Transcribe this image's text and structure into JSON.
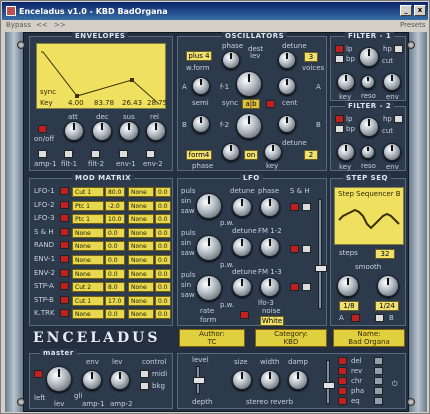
{
  "window": {
    "title": "Enceladus v1.0 - KBD BadOrgana",
    "bypass": "Bypass",
    "nav_prev": "<<",
    "nav_next": ">>",
    "presets": "Presets",
    "close": "x",
    "minimize": "_"
  },
  "envelopes": {
    "title": "ENVELOPES",
    "sync": "sync",
    "key": "Key",
    "values": [
      "4.00",
      "83.78",
      "26.43",
      "28.75"
    ],
    "params": [
      "att",
      "dec",
      "sus",
      "rel"
    ],
    "onoff": "on/off",
    "rows": [
      "amp-1",
      "filt-1",
      "filt-2",
      "env-1",
      "env-2"
    ]
  },
  "oscillators": {
    "title": "OSCILLATORS",
    "preset1": "plus 4",
    "preset2": "form4",
    "phase": "phase",
    "wform": "w.form",
    "dest": "dest",
    "lev": "lev",
    "detune": "detune",
    "voices": "voices",
    "voices1": "3",
    "voices2": "2",
    "semi": "semi",
    "sync": "sync",
    "ab": "a|b",
    "cent": "cent",
    "fmix": "f-1",
    "fmix2": "f-2",
    "on": "on",
    "key": "key",
    "a": "A",
    "b": "B"
  },
  "filter1": {
    "title": "FILTER - 1",
    "lp": "lp",
    "bp": "bp",
    "hp": "hp",
    "cut": "cut",
    "res": "reso",
    "env": "env",
    "key": "key"
  },
  "filter2": {
    "title": "FILTER - 2",
    "lp": "lp",
    "bp": "bp",
    "hp": "hp",
    "cut": "cut",
    "res": "reso",
    "env": "env",
    "key": "key"
  },
  "modmatrix": {
    "title": "MOD MATRIX",
    "rows": [
      {
        "src": "LFO-1",
        "dest": "Cut 1",
        "amt": "80.0",
        "dest2": "None",
        "amt2": "0.0"
      },
      {
        "src": "LFO-2",
        "dest": "Ptc 1",
        "amt": "-2.0",
        "dest2": "None",
        "amt2": "0.0"
      },
      {
        "src": "LFO-3",
        "dest": "Ptc 1",
        "amt": "10.0",
        "dest2": "None",
        "amt2": "0.0"
      },
      {
        "src": "S & H",
        "dest": "None",
        "amt": "0.0",
        "dest2": "None",
        "amt2": "0.0"
      },
      {
        "src": "RAND",
        "dest": "None",
        "amt": "0.0",
        "dest2": "None",
        "amt2": "0.0"
      },
      {
        "src": "ENV-1",
        "dest": "None",
        "amt": "0.0",
        "dest2": "None",
        "amt2": "0.0"
      },
      {
        "src": "ENV-2",
        "dest": "None",
        "amt": "0.0",
        "dest2": "None",
        "amt2": "0.0"
      },
      {
        "src": "STP-A",
        "dest": "Cut 2",
        "amt": "8.0",
        "dest2": "None",
        "amt2": "0.0"
      },
      {
        "src": "STP-B",
        "dest": "Cut 1",
        "amt": "17.0",
        "dest2": "None",
        "amt2": "0.0"
      },
      {
        "src": "K.TRK",
        "dest": "None",
        "amt": "0.0",
        "dest2": "None",
        "amt2": "0.0"
      }
    ]
  },
  "lfo": {
    "title": "LFO",
    "puls": "puls",
    "sin": "sin",
    "saw": "saw",
    "rate": "rate",
    "detune": "detune",
    "phase": "phase",
    "pw": "p.w.",
    "fm12": "FM 1-2",
    "fm13": "FM 1-3",
    "sh": "S & H",
    "noise": "noise",
    "white": "White",
    "lfo3": "lfo-3",
    "tc": "tc",
    "form": "form"
  },
  "stepseq": {
    "title": "STEP SEQ",
    "name": "Step Sequencer B",
    "steps_label": "steps",
    "steps": "32",
    "smooth": "smooth",
    "v1": "1/8",
    "v2": "1/24",
    "a": "A",
    "b": "B"
  },
  "brand": {
    "logo": "ENCELADUS",
    "author_label": "Author:",
    "author": "TC",
    "category_label": "Category:",
    "category": "KBD",
    "name_label": "Name:",
    "name": "Bad Organa"
  },
  "master": {
    "title": "master",
    "lev": "lev",
    "env": "env",
    "gli": "gli",
    "amp1": "amp-1",
    "amp2": "amp-2",
    "control": "control",
    "midi": "midi",
    "bkg": "bkg",
    "left": "left"
  },
  "fx": {
    "level": "level",
    "depth": "depth",
    "size": "size",
    "width": "width",
    "damp": "damp",
    "stereo_reverb": "stereo reverb",
    "items": [
      "del",
      "rev",
      "chr",
      "pha",
      "eq"
    ]
  }
}
